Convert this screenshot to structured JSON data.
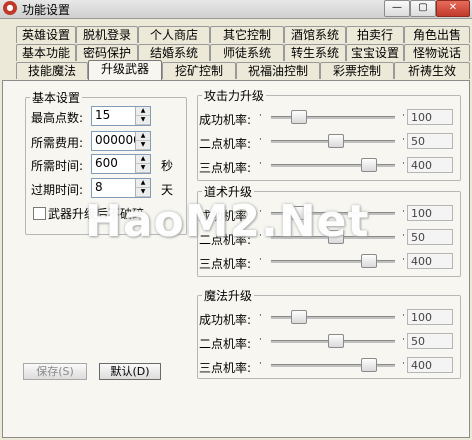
{
  "window": {
    "title": "功能设置",
    "min": "—",
    "max": "▢",
    "close": "✕"
  },
  "tabs": {
    "row1": [
      "英雄设置",
      "脱机登录",
      "个人商店",
      "其它控制",
      "酒馆系统",
      "拍卖行",
      "角色出售"
    ],
    "row2": [
      "基本功能",
      "密码保护",
      "结婚系统",
      "师徒系统",
      "转生系统",
      "宝宝设置",
      "怪物说话"
    ],
    "row3": [
      "技能魔法",
      "升级武器",
      "挖矿控制",
      "祝福油控制",
      "彩票控制",
      "祈祷生效"
    ],
    "active": "升级武器"
  },
  "basic": {
    "legend": "基本设置",
    "max_points": {
      "label": "最高点数:",
      "value": "15"
    },
    "cost": {
      "label": "所需费用:",
      "value": "000000"
    },
    "time": {
      "label": "所需时间:",
      "value": "600",
      "unit": "秒"
    },
    "expire": {
      "label": "过期时间:",
      "value": "8",
      "unit": "天"
    },
    "checkbox": {
      "label": "武器升级后不破碎",
      "checked": false
    }
  },
  "groups": [
    {
      "legend": "攻击力升级",
      "rows": [
        {
          "label": "成功机率:",
          "value": "100",
          "level": 0.18
        },
        {
          "label": "二点机率:",
          "value": "50",
          "level": 0.52
        },
        {
          "label": "三点机率:",
          "value": "400",
          "level": 0.82
        }
      ]
    },
    {
      "legend": "道术升级",
      "rows": [
        {
          "label": "成功机率:",
          "value": "100",
          "level": 0.18
        },
        {
          "label": "二点机率:",
          "value": "50",
          "level": 0.52
        },
        {
          "label": "三点机率:",
          "value": "400",
          "level": 0.82
        }
      ]
    },
    {
      "legend": "魔法升级",
      "rows": [
        {
          "label": "成功机率:",
          "value": "100",
          "level": 0.18
        },
        {
          "label": "二点机率:",
          "value": "50",
          "level": 0.52
        },
        {
          "label": "三点机率:",
          "value": "400",
          "level": 0.82
        }
      ]
    }
  ],
  "buttons": {
    "save": "保存(S)",
    "default": "默认(D)"
  },
  "slider_marks": {
    "left": "·",
    "right": "·"
  },
  "watermark": "HaoM2.Net"
}
